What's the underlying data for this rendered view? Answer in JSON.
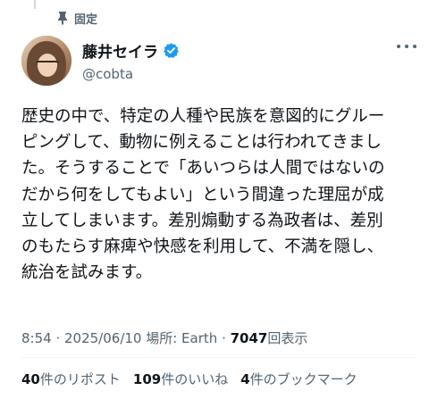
{
  "pinned": {
    "label": "固定"
  },
  "author": {
    "display_name": "藤井セイラ",
    "handle": "@cobta",
    "verified_color": "#1d9bf0"
  },
  "post": {
    "lines": [
      "歴史の中で、特定の人種や民族を意図的にグルー",
      "ピングして、動物に例えることは行われてきまし",
      "た。そうすることで「あいつらは人間ではないの",
      "だから何をしてもよい」という間違った理屈が成",
      "立してしまいます。差別煽動する為政者は、差別",
      "のもたらす麻痺や快感を利用して、不満を隠し、",
      "統治を試みます。"
    ]
  },
  "meta": {
    "time": "8:54",
    "separator1": " · ",
    "date": "2025/06/10",
    "location": " 場所: Earth",
    "separator2": " · ",
    "views_count": "7047",
    "views_label": "回表示"
  },
  "stats": {
    "reposts_count": "40",
    "reposts_label": "件のリポスト",
    "likes_count": "109",
    "likes_label": "件のいいね",
    "bookmarks_count": "4",
    "bookmarks_label": "件のブックマーク"
  },
  "icons": {
    "pin": "pin-icon",
    "verified": "verified-badge-icon",
    "more": "more-options-icon"
  }
}
